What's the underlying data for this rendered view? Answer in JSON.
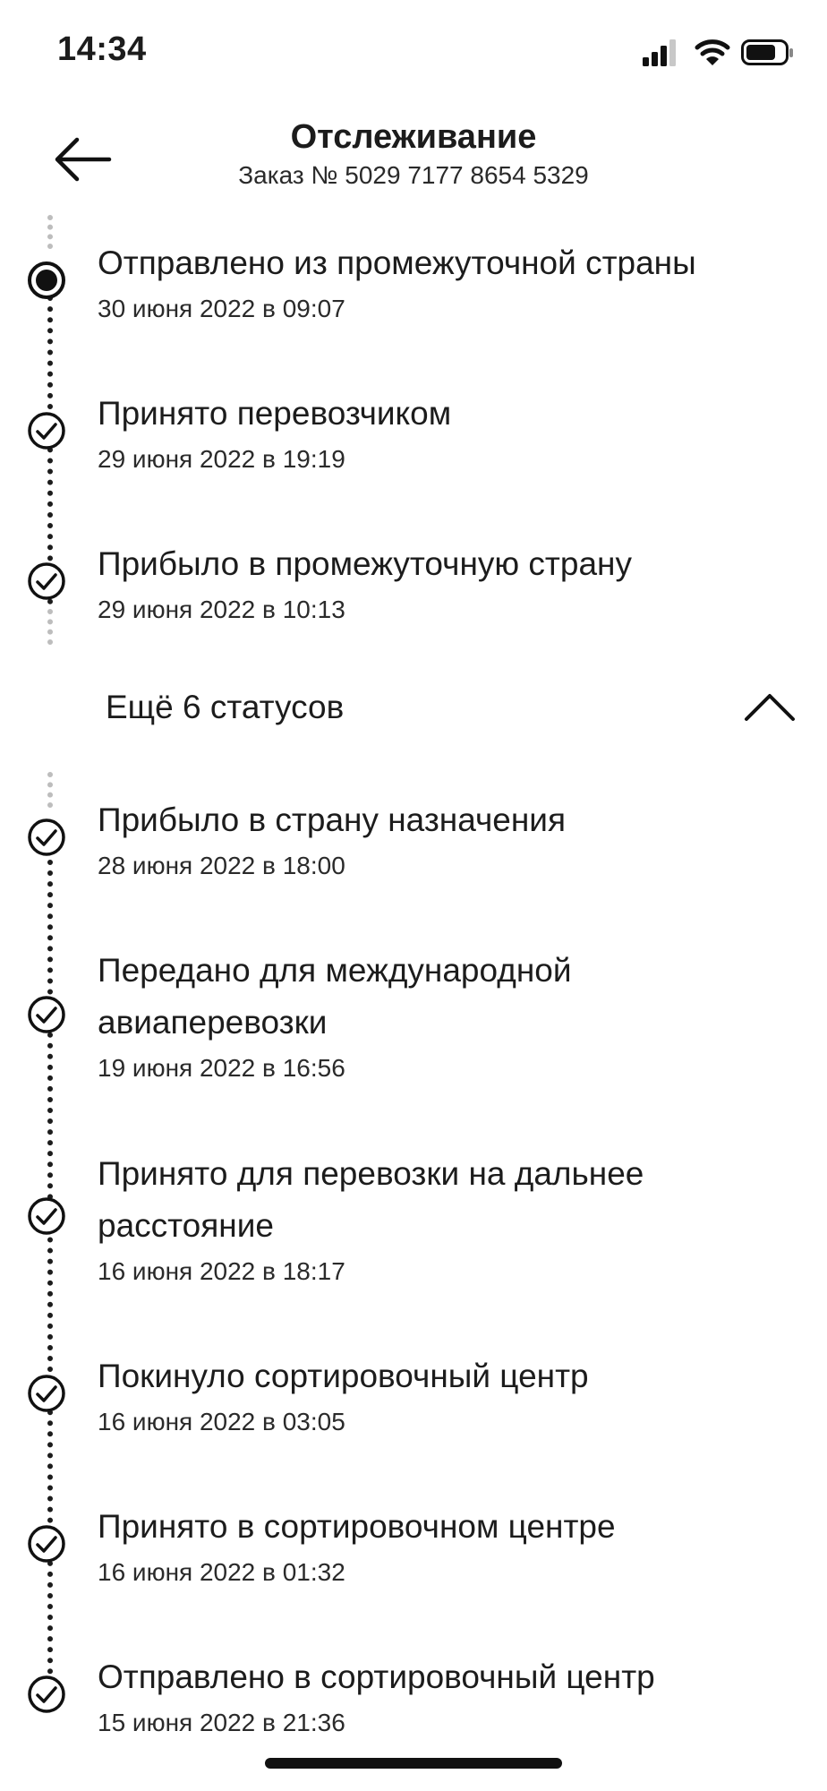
{
  "status_bar": {
    "time": "14:34",
    "icons": [
      "cellular-signal-icon",
      "wifi-icon",
      "battery-icon"
    ]
  },
  "header": {
    "back_icon": "arrow-left-icon",
    "title": "Отслеживание",
    "subtitle": "Заказ № 5029 7177 8654 5329"
  },
  "recent_statuses": [
    {
      "title": "Отправлено из промежуточной страны",
      "date": "30 июня 2022 в 09:07",
      "current": true
    },
    {
      "title": "Принято перевозчиком",
      "date": "29 июня 2022 в 19:19",
      "current": false
    },
    {
      "title": "Прибыло в промежуточную страну",
      "date": "29 июня 2022 в 10:13",
      "current": false
    }
  ],
  "more": {
    "label": "Ещё 6 статусов",
    "icon": "chevron-up-icon"
  },
  "older_statuses": [
    {
      "title": "Прибыло в страну назначения",
      "date": "28 июня 2022 в 18:00"
    },
    {
      "title": "Передано для международной авиаперевозки",
      "date": "19 июня 2022 в 16:56"
    },
    {
      "title": "Принято для перевозки на дальнее расстояние",
      "date": "16 июня 2022 в 18:17"
    },
    {
      "title": "Покинуло сортировочный центр",
      "date": "16 июня 2022 в 03:05"
    },
    {
      "title": "Принято в сортировочном центре",
      "date": "16 июня 2022 в 01:32"
    },
    {
      "title": "Отправлено в сортировочный центр",
      "date": "15 июня 2022 в 21:36"
    }
  ]
}
